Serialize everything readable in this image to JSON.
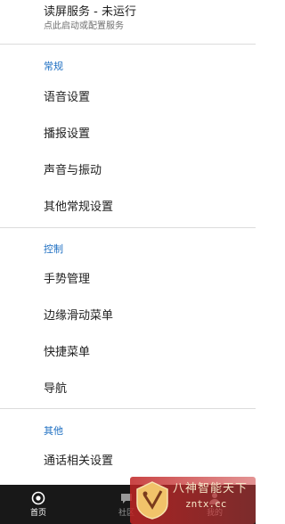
{
  "screen_reader": {
    "title": "读屏服务 - 未运行",
    "subtitle": "点此启动或配置服务"
  },
  "sections": [
    {
      "header": "常规",
      "items": [
        "语音设置",
        "播报设置",
        "声音与振动",
        "其他常规设置"
      ]
    },
    {
      "header": "控制",
      "items": [
        "手势管理",
        "边缘滑动菜单",
        "快捷菜单",
        "导航"
      ]
    },
    {
      "header": "其他",
      "items": [
        "通话相关设置"
      ]
    }
  ],
  "bottom_nav": {
    "items": [
      {
        "label": "首页",
        "icon": "home-icon",
        "active": true
      },
      {
        "label": "社区",
        "icon": "community-icon",
        "active": false
      },
      {
        "label": "我的",
        "icon": "profile-icon",
        "active": false
      }
    ]
  },
  "watermark": {
    "line1": "八神智能天下",
    "line2": "zntx.cc"
  },
  "colors": {
    "section_header": "#1e6fc2",
    "nav_background": "#181818",
    "divider": "#dcdcdc"
  }
}
